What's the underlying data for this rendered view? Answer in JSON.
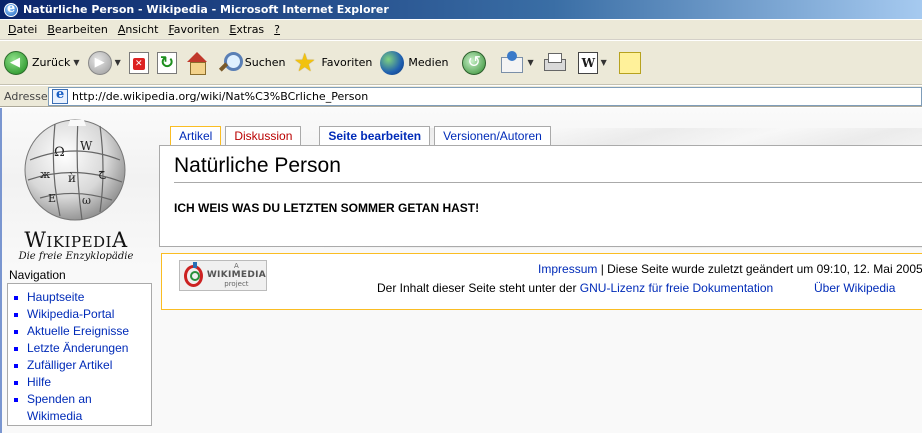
{
  "window": {
    "title": "Natürliche Person - Wikipedia - Microsoft Internet Explorer"
  },
  "menu": [
    {
      "label": "Datei",
      "accel": "D",
      "rest": "atei"
    },
    {
      "label": "Bearbeiten",
      "accel": "B",
      "rest": "earbeiten"
    },
    {
      "label": "Ansicht",
      "accel": "A",
      "rest": "nsicht"
    },
    {
      "label": "Favoriten",
      "accel": "F",
      "rest": "avoriten"
    },
    {
      "label": "Extras",
      "accel": "E",
      "rest": "xtras"
    },
    {
      "label": "?",
      "accel": "?",
      "rest": ""
    }
  ],
  "toolbar": {
    "back_label": "Zurück",
    "search_label": "Suchen",
    "favorites_label": "Favoriten",
    "media_label": "Medien"
  },
  "address": {
    "label": "Adresse",
    "url": "http://de.wikipedia.org/wiki/Nat%C3%BCrliche_Person"
  },
  "logo": {
    "wordmark_first": "W",
    "wordmark_rest": "IKIPEDI",
    "wordmark_last": "A",
    "tagline": "Die freie Enzyklopädie"
  },
  "tabs": {
    "article": "Artikel",
    "discussion": "Diskussion",
    "edit": "Seite bearbeiten",
    "history": "Versionen/Autoren"
  },
  "article": {
    "heading": "Natürliche Person",
    "body": "ICH WEIS WAS DU LETZTEN SOMMER GETAN HAST!"
  },
  "navigation": {
    "heading": "Navigation",
    "items": [
      {
        "label": "Hauptseite"
      },
      {
        "label": "Wikipedia-Portal"
      },
      {
        "label": "Aktuelle Ereignisse"
      },
      {
        "label": "Letzte Änderungen"
      },
      {
        "label": "Zufälliger Artikel"
      },
      {
        "label": "Hilfe"
      },
      {
        "label": "Spenden an Wikimedia"
      }
    ]
  },
  "footer": {
    "badge_top": "A",
    "badge_name": "WIKIMEDIA",
    "badge_bottom": "project",
    "impressum": "Impressum",
    "last_modified": " | Diese Seite wurde zuletzt geändert um 09:10, 12. Mai 2005.",
    "license_prefix": "Der Inhalt dieser Seite steht unter der ",
    "license_link": "GNU-Lizenz für freie Dokumentation",
    "about": "Über Wikipedia"
  },
  "colors": {
    "link": "#002bb8",
    "new_link": "#ba0000",
    "tab_selected_border": "#fabd23",
    "titlebar": "#0a246a"
  },
  "icons": [
    "ie-icon",
    "back-icon",
    "forward-icon",
    "stop-icon",
    "refresh-icon",
    "home-icon",
    "search-icon",
    "favorites-icon",
    "media-icon",
    "history-icon",
    "mail-icon",
    "print-icon",
    "word-icon",
    "note-icon",
    "page-icon",
    "wikipedia-globe-icon",
    "wikimedia-logo-icon"
  ]
}
